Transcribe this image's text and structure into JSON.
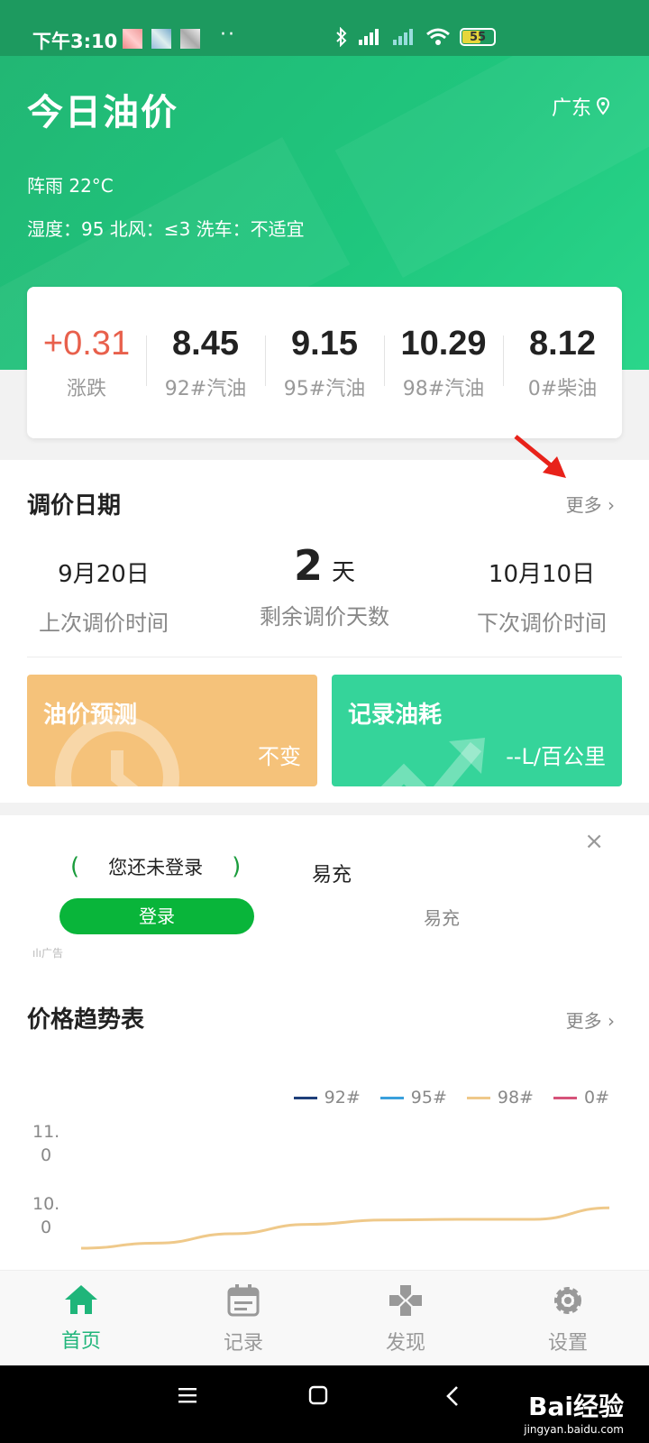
{
  "status_bar": {
    "time": "下午3:10",
    "dots": "··",
    "battery": "55"
  },
  "header": {
    "title": "今日油价",
    "location": "广东",
    "weather": "阵雨 22°C",
    "weather_detail": "湿度：95  北风：≤3  洗车：不适宜"
  },
  "prices": [
    {
      "value": "+0.31",
      "label": "涨跌"
    },
    {
      "value": "8.45",
      "label": "92#汽油"
    },
    {
      "value": "9.15",
      "label": "95#汽油"
    },
    {
      "value": "10.29",
      "label": "98#汽油"
    },
    {
      "value": "8.12",
      "label": "0#柴油"
    }
  ],
  "adjust": {
    "title": "调价日期",
    "more": "更多",
    "last_date": "9月20日",
    "last_label": "上次调价时间",
    "days": "2",
    "days_unit": "天",
    "days_label": "剩余调价天数",
    "next_date": "10月10日",
    "next_label": "下次调价时间"
  },
  "tiles": {
    "forecast_title": "油价预测",
    "forecast_value": "不变",
    "record_title": "记录油耗",
    "record_value": "--L/百公里"
  },
  "ad": {
    "login_hint": "您还未登录",
    "open_paren": "(",
    "close_paren": ")",
    "login_button": "登录",
    "brand": "易充",
    "brand_sub": "易充",
    "ad_label": "广告",
    "close": "×"
  },
  "trend": {
    "title": "价格趋势表",
    "more": "更多"
  },
  "chart_data": {
    "type": "line",
    "series": [
      {
        "name": "92#",
        "color": "#1f3f7a",
        "values": []
      },
      {
        "name": "95#",
        "color": "#3aa0dc",
        "values": []
      },
      {
        "name": "98#",
        "color": "#efc98a",
        "values": [
          9.55,
          9.62,
          9.75,
          9.88,
          9.94,
          9.95,
          9.95,
          10.11
        ]
      },
      {
        "name": "0#",
        "color": "#d6537a",
        "values": []
      }
    ],
    "yticks": [
      "11.\n0",
      "10.\n0"
    ],
    "ylim": [
      9.55,
      11.2
    ],
    "xlabel": "",
    "ylabel": ""
  },
  "tabbar": [
    {
      "label": "首页",
      "icon": "home-icon",
      "active": true
    },
    {
      "label": "记录",
      "icon": "calendar-icon",
      "active": false
    },
    {
      "label": "发现",
      "icon": "gamepad-icon",
      "active": false
    },
    {
      "label": "设置",
      "icon": "gear-icon",
      "active": false
    }
  ],
  "watermark": {
    "main": "Bai经验",
    "sub": "jingyan.baidu.com"
  },
  "colors": {
    "brand_green": "#1fb57a",
    "rise_red": "#e8604c"
  }
}
